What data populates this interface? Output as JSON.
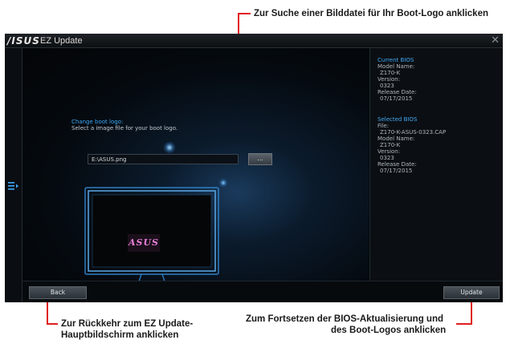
{
  "callouts": {
    "top": "Zur Suche einer Bilddatei für Ihr Boot-Logo anklicken",
    "bottom_left_1": "Zur Rückkehr zum EZ Update-",
    "bottom_left_2": "Hauptbildschirm anklicken",
    "bottom_right_1": "Zum Fortsetzen der BIOS-Aktualisierung und",
    "bottom_right_2": "des Boot-Logos anklicken"
  },
  "window": {
    "brand": "/ISUS",
    "title": "EZ Update",
    "close": "✕"
  },
  "main": {
    "heading": "Change boot logo:",
    "instruction": "Select a image file for your boot logo.",
    "file_path": "E:\\ASUS.png",
    "browse_label": "...",
    "logo_preview": "ASUS"
  },
  "current_bios": {
    "heading": "Current BIOS",
    "model_label": "Model Name:",
    "model": "Z170-K",
    "version_label": "Version:",
    "version": "0323",
    "date_label": "Release Date:",
    "date": "07/17/2015"
  },
  "selected_bios": {
    "heading": "Selected BIOS",
    "file_label": "File:",
    "file": "Z170-K-ASUS-0323.CAP",
    "model_label": "Model Name:",
    "model": "Z170-K",
    "version_label": "Version:",
    "version": "0323",
    "date_label": "Release Date:",
    "date": "07/17/2015"
  },
  "buttons": {
    "back": "Back",
    "update": "Update"
  },
  "colors": {
    "callout_line": "#e01e1e",
    "accent": "#3fa9f5"
  }
}
